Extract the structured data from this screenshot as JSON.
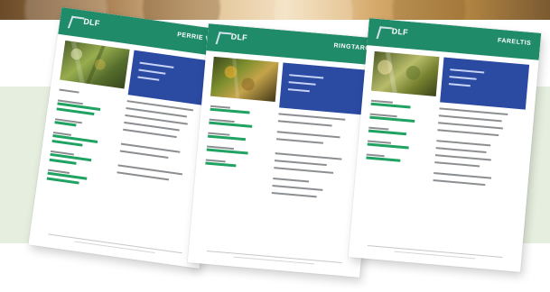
{
  "cards": [
    {
      "logo": "DLF",
      "title": "PERRIE VIRA"
    },
    {
      "logo": "DLF",
      "title": "RINGTARG"
    },
    {
      "logo": "DLF",
      "title": "FARELTIS"
    }
  ],
  "colors": {
    "header_green": "#1f8b68",
    "blue_box": "#2b4aa2",
    "highlight_green": "#1fa262",
    "band_green": "#e6efdf"
  }
}
